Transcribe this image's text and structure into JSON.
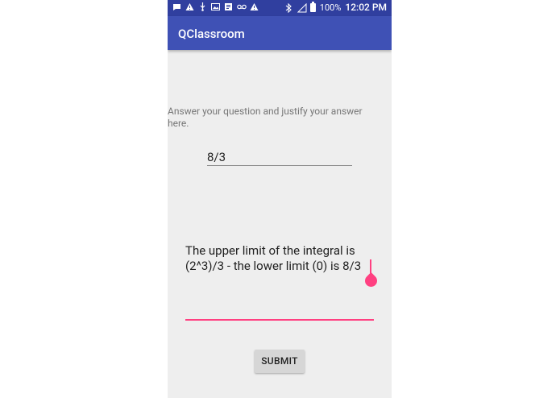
{
  "status_bar": {
    "icons": [
      "message-icon",
      "alert-icon",
      "usb-icon",
      "image-icon",
      "note-icon",
      "voicemail-icon",
      "alert-icon",
      "bluetooth-icon",
      "no-signal-icon",
      "battery-icon"
    ],
    "battery": "100%",
    "time": "12:02 PM"
  },
  "app_bar": {
    "title": "QClassroom"
  },
  "form": {
    "prompt": "Answer your question and justify your answer here.",
    "answer_value": "8/3",
    "justification_value": "The upper limit of the integral is\n(2^3)/3 - the lower limit (0) is 8/3",
    "submit_label": "SUBMIT"
  },
  "colors": {
    "primary": "#3f51b5",
    "primary_dark": "#303f9f",
    "accent": "#ff4081",
    "background": "#eeeeee"
  }
}
